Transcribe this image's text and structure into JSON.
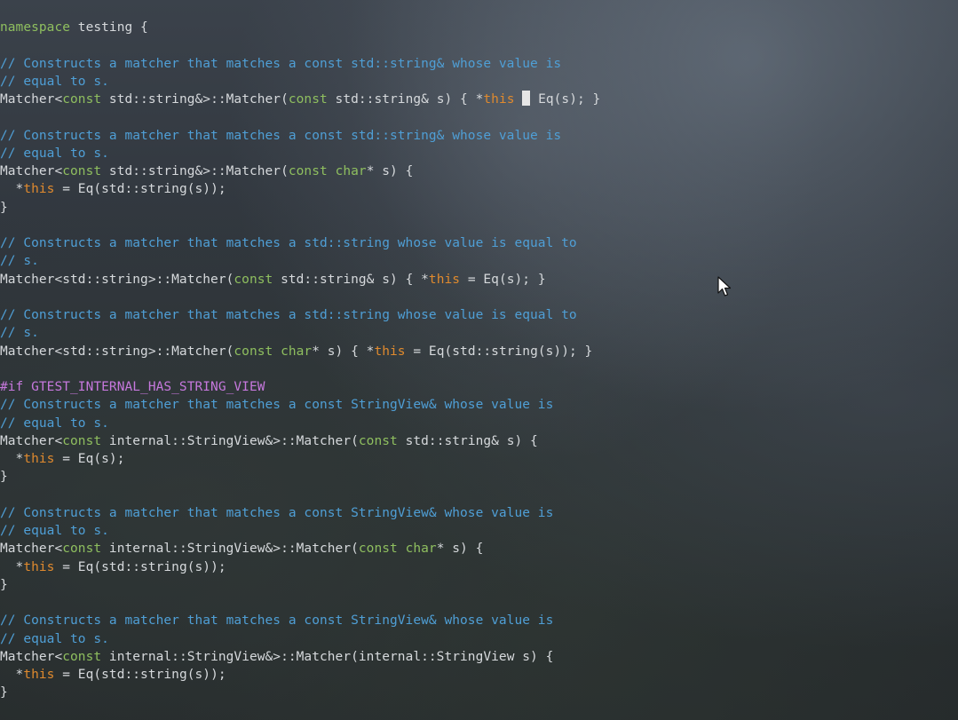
{
  "editor": {
    "lines": [
      [
        {
          "t": "kw",
          "v": "namespace"
        },
        {
          "t": "plain",
          "v": " testing {"
        }
      ],
      [],
      [
        {
          "t": "comment",
          "v": "// Constructs a matcher that matches a const std::string& whose value is"
        }
      ],
      [
        {
          "t": "comment",
          "v": "// equal to s."
        }
      ],
      [
        {
          "t": "plain",
          "v": "Matcher<"
        },
        {
          "t": "kw",
          "v": "const"
        },
        {
          "t": "plain",
          "v": " std::string&>::Matcher("
        },
        {
          "t": "kw",
          "v": "const"
        },
        {
          "t": "plain",
          "v": " std::string& s) { *"
        },
        {
          "t": "this",
          "v": "this"
        },
        {
          "t": "plain",
          "v": " "
        },
        {
          "t": "cursor",
          "v": ""
        },
        {
          "t": "plain",
          "v": " Eq(s); }"
        }
      ],
      [],
      [
        {
          "t": "comment",
          "v": "// Constructs a matcher that matches a const std::string& whose value is"
        }
      ],
      [
        {
          "t": "comment",
          "v": "// equal to s."
        }
      ],
      [
        {
          "t": "plain",
          "v": "Matcher<"
        },
        {
          "t": "kw",
          "v": "const"
        },
        {
          "t": "plain",
          "v": " std::string&>::Matcher("
        },
        {
          "t": "kw",
          "v": "const"
        },
        {
          "t": "plain",
          "v": " "
        },
        {
          "t": "kw",
          "v": "char"
        },
        {
          "t": "plain",
          "v": "* s) {"
        }
      ],
      [
        {
          "t": "plain",
          "v": "  *"
        },
        {
          "t": "this",
          "v": "this"
        },
        {
          "t": "plain",
          "v": " = Eq(std::string(s));"
        }
      ],
      [
        {
          "t": "plain",
          "v": "}"
        }
      ],
      [],
      [
        {
          "t": "comment",
          "v": "// Constructs a matcher that matches a std::string whose value is equal to"
        }
      ],
      [
        {
          "t": "comment",
          "v": "// s."
        }
      ],
      [
        {
          "t": "plain",
          "v": "Matcher<std::string>::Matcher("
        },
        {
          "t": "kw",
          "v": "const"
        },
        {
          "t": "plain",
          "v": " std::string& s) { *"
        },
        {
          "t": "this",
          "v": "this"
        },
        {
          "t": "plain",
          "v": " = Eq(s); }"
        }
      ],
      [],
      [
        {
          "t": "comment",
          "v": "// Constructs a matcher that matches a std::string whose value is equal to"
        }
      ],
      [
        {
          "t": "comment",
          "v": "// s."
        }
      ],
      [
        {
          "t": "plain",
          "v": "Matcher<std::string>::Matcher("
        },
        {
          "t": "kw",
          "v": "const"
        },
        {
          "t": "plain",
          "v": " "
        },
        {
          "t": "kw",
          "v": "char"
        },
        {
          "t": "plain",
          "v": "* s) { *"
        },
        {
          "t": "this",
          "v": "this"
        },
        {
          "t": "plain",
          "v": " = Eq(std::string(s)); }"
        }
      ],
      [],
      [
        {
          "t": "pre",
          "v": "#if GTEST_INTERNAL_HAS_STRING_VIEW"
        }
      ],
      [
        {
          "t": "comment",
          "v": "// Constructs a matcher that matches a const StringView& whose value is"
        }
      ],
      [
        {
          "t": "comment",
          "v": "// equal to s."
        }
      ],
      [
        {
          "t": "plain",
          "v": "Matcher<"
        },
        {
          "t": "kw",
          "v": "const"
        },
        {
          "t": "plain",
          "v": " internal::StringView&>::Matcher("
        },
        {
          "t": "kw",
          "v": "const"
        },
        {
          "t": "plain",
          "v": " std::string& s) {"
        }
      ],
      [
        {
          "t": "plain",
          "v": "  *"
        },
        {
          "t": "this",
          "v": "this"
        },
        {
          "t": "plain",
          "v": " = Eq(s);"
        }
      ],
      [
        {
          "t": "plain",
          "v": "}"
        }
      ],
      [],
      [
        {
          "t": "comment",
          "v": "// Constructs a matcher that matches a const StringView& whose value is"
        }
      ],
      [
        {
          "t": "comment",
          "v": "// equal to s."
        }
      ],
      [
        {
          "t": "plain",
          "v": "Matcher<"
        },
        {
          "t": "kw",
          "v": "const"
        },
        {
          "t": "plain",
          "v": " internal::StringView&>::Matcher("
        },
        {
          "t": "kw",
          "v": "const"
        },
        {
          "t": "plain",
          "v": " "
        },
        {
          "t": "kw",
          "v": "char"
        },
        {
          "t": "plain",
          "v": "* s) {"
        }
      ],
      [
        {
          "t": "plain",
          "v": "  *"
        },
        {
          "t": "this",
          "v": "this"
        },
        {
          "t": "plain",
          "v": " = Eq(std::string(s));"
        }
      ],
      [
        {
          "t": "plain",
          "v": "}"
        }
      ],
      [],
      [
        {
          "t": "comment",
          "v": "// Constructs a matcher that matches a const StringView& whose value is"
        }
      ],
      [
        {
          "t": "comment",
          "v": "// equal to s."
        }
      ],
      [
        {
          "t": "plain",
          "v": "Matcher<"
        },
        {
          "t": "kw",
          "v": "const"
        },
        {
          "t": "plain",
          "v": " internal::StringView&>::Matcher(internal::StringView s) {"
        }
      ],
      [
        {
          "t": "plain",
          "v": "  *"
        },
        {
          "t": "this",
          "v": "this"
        },
        {
          "t": "plain",
          "v": " = Eq(std::string(s));"
        }
      ],
      [
        {
          "t": "plain",
          "v": "}"
        }
      ]
    ]
  },
  "colors": {
    "keyword": "#8fbf5f",
    "this_keyword": "#e08a2e",
    "comment": "#4f9fd6",
    "preprocessor": "#c678dd",
    "text": "#d6d9dc",
    "cursor": "#e6e6e6"
  },
  "icons": {
    "pointer": "mouse-pointer-icon"
  }
}
